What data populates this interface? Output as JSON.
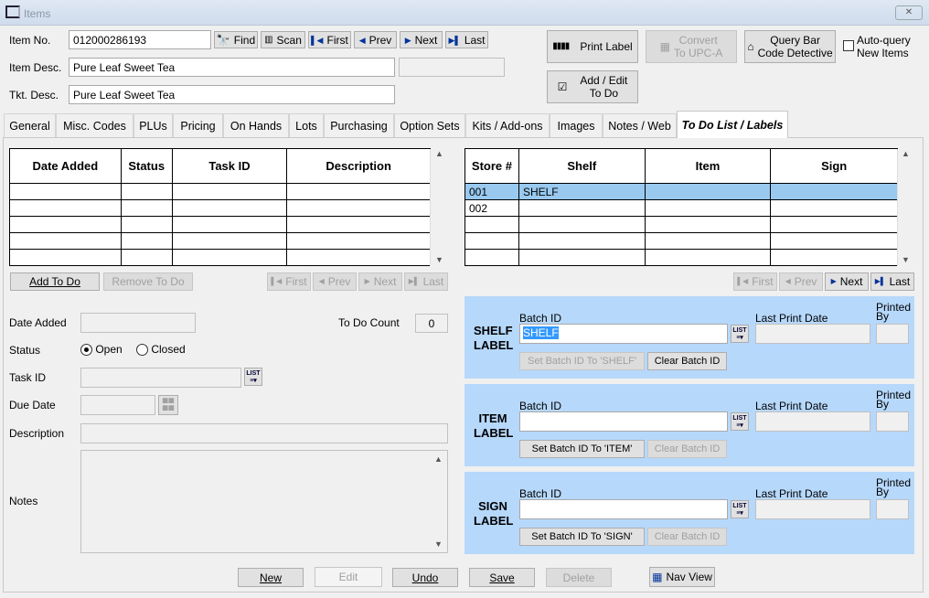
{
  "window": {
    "title": "Items",
    "close": "✕"
  },
  "header": {
    "item_no_label": "Item No.",
    "item_no": "012000286193",
    "item_desc_label": "Item Desc.",
    "item_desc": "Pure Leaf Sweet Tea",
    "item_desc_extra": "",
    "tkt_desc_label": "Tkt. Desc.",
    "tkt_desc": "Pure Leaf Sweet Tea",
    "find": "Find",
    "scan": "Scan",
    "first": "First",
    "prev": "Prev",
    "next": "Next",
    "last": "Last",
    "print_label": "Print Label",
    "convert_1": "Convert",
    "convert_2": "To UPC-A",
    "query_1": "Query Bar",
    "query_2": "Code Detective",
    "auto_query_1": "Auto-query",
    "auto_query_2": "New Items",
    "auto_query_checked": false,
    "add_edit_1": "Add / Edit",
    "add_edit_2": "To Do"
  },
  "tabs": [
    "General",
    "Misc. Codes",
    "PLUs",
    "Pricing",
    "On Hands",
    "Lots",
    "Purchasing",
    "Option Sets",
    "Kits / Add-ons",
    "Images",
    "Notes / Web",
    "To Do List / Labels"
  ],
  "active_tab": "To Do List / Labels",
  "todo_grid": {
    "columns": [
      "Date Added",
      "Status",
      "Task ID",
      "Description"
    ],
    "rows": [
      [
        "",
        "",
        "",
        ""
      ],
      [
        "",
        "",
        "",
        ""
      ],
      [
        "",
        "",
        "",
        ""
      ],
      [
        "",
        "",
        "",
        ""
      ],
      [
        "",
        "",
        "",
        ""
      ]
    ]
  },
  "store_grid": {
    "columns": [
      "Store #",
      "Shelf",
      "Item",
      "Sign"
    ],
    "rows": [
      [
        "001",
        "SHELF",
        "",
        ""
      ],
      [
        "002",
        "",
        "",
        ""
      ],
      [
        "",
        "",
        "",
        ""
      ],
      [
        "",
        "",
        "",
        ""
      ],
      [
        "",
        "",
        "",
        ""
      ]
    ],
    "selected_row": 0
  },
  "todo_buttons": {
    "add": "Add To Do",
    "remove": "Remove To Do"
  },
  "nav": {
    "first": "First",
    "prev": "Prev",
    "next": "Next",
    "last": "Last"
  },
  "form": {
    "date_added_label": "Date Added",
    "date_added": "",
    "todo_count_label": "To Do Count",
    "todo_count": "0",
    "status_label": "Status",
    "open": "Open",
    "closed": "Closed",
    "status_value": "Open",
    "task_id_label": "Task ID",
    "task_id": "",
    "due_date_label": "Due Date",
    "due_date": "",
    "description_label": "Description",
    "description": "",
    "notes_label": "Notes",
    "notes": ""
  },
  "labels": [
    {
      "title_1": "SHELF",
      "title_2": "LABEL",
      "batch_label": "Batch ID",
      "batch_id": "SHELF",
      "last_print_label": "Last Print Date",
      "last_print": "",
      "printed_by_1": "Printed",
      "printed_by_2": "By",
      "printed_by": "",
      "set_btn": "Set Batch ID To 'SHELF'",
      "clear_btn": "Clear Batch ID",
      "set_enabled": false,
      "clear_enabled": true
    },
    {
      "title_1": "ITEM",
      "title_2": "LABEL",
      "batch_label": "Batch ID",
      "batch_id": "",
      "last_print_label": "Last Print Date",
      "last_print": "",
      "printed_by_1": "Printed",
      "printed_by_2": "By",
      "printed_by": "",
      "set_btn": "Set Batch ID To 'ITEM'",
      "clear_btn": "Clear Batch ID",
      "set_enabled": true,
      "clear_enabled": false
    },
    {
      "title_1": "SIGN",
      "title_2": "LABEL",
      "batch_label": "Batch ID",
      "batch_id": "",
      "last_print_label": "Last Print Date",
      "last_print": "",
      "printed_by_1": "Printed",
      "printed_by_2": "By",
      "printed_by": "",
      "set_btn": "Set Batch ID To 'SIGN'",
      "clear_btn": "Clear Batch ID",
      "set_enabled": true,
      "clear_enabled": false
    }
  ],
  "footer": {
    "new": "New",
    "edit": "Edit",
    "undo": "Undo",
    "save": "Save",
    "delete": "Delete",
    "nav_view": "Nav View"
  },
  "colors": {
    "label_panel": "#b6d8fb",
    "selected_row": "#99c9ef",
    "selection": "#3399ff"
  }
}
